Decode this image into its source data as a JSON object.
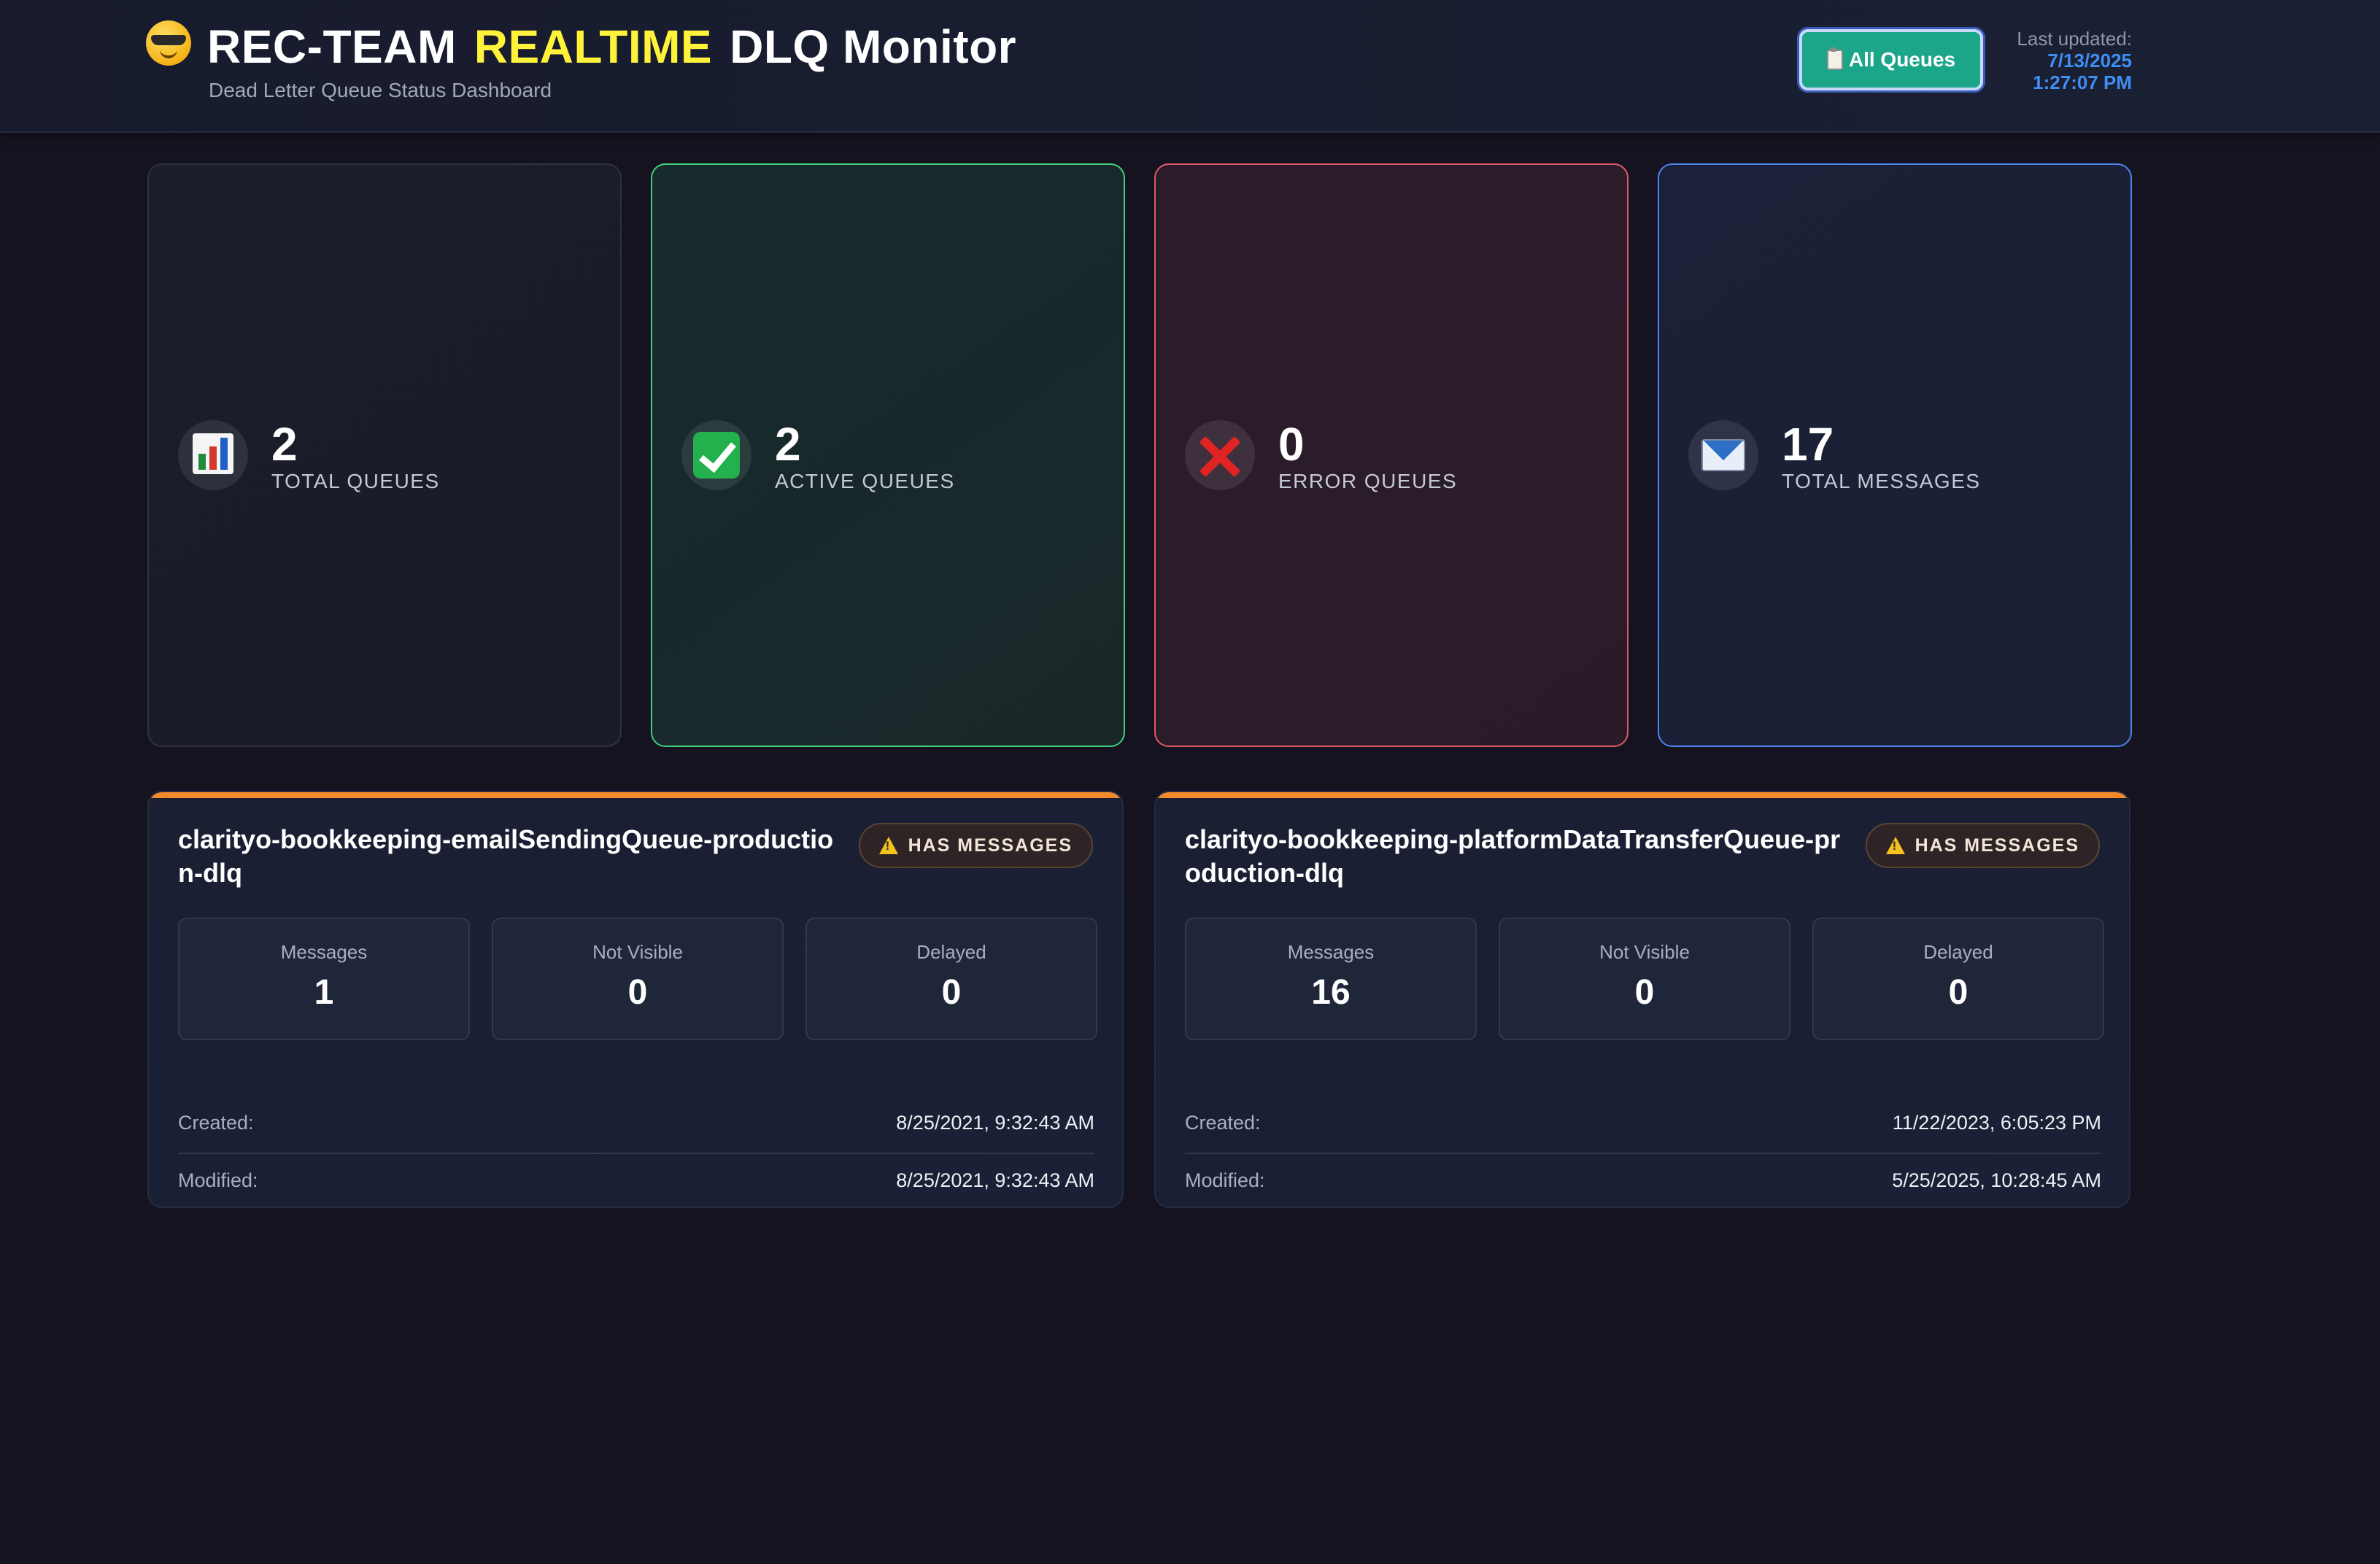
{
  "header": {
    "title_part1": "REC-TEAM",
    "title_part2": "REALTIME",
    "title_part3": "DLQ Monitor",
    "subtitle": "Dead Letter Queue Status Dashboard",
    "brand_icon": "sunglasses-face-icon",
    "all_queues_button": "All Queues",
    "all_queues_icon": "clipboard-icon",
    "last_updated_label": "Last updated:",
    "last_updated_date": "7/13/2025",
    "last_updated_time": "1:27:07 PM"
  },
  "stats": [
    {
      "value": "2",
      "label": "TOTAL QUEUES",
      "icon": "bar-chart-icon"
    },
    {
      "value": "2",
      "label": "ACTIVE QUEUES",
      "icon": "check-mark-icon",
      "accent": "#3fd07a"
    },
    {
      "value": "0",
      "label": "ERROR QUEUES",
      "icon": "cross-mark-icon",
      "accent": "#e0586a"
    },
    {
      "value": "17",
      "label": "TOTAL MESSAGES",
      "icon": "envelope-icon",
      "accent": "#4d84ee"
    }
  ],
  "queues": [
    {
      "name": "clarityo-bookkeeping-emailSendingQueue-production-dlq",
      "status": "HAS MESSAGES",
      "messages_label": "Messages",
      "messages": "1",
      "not_visible_label": "Not Visible",
      "not_visible": "0",
      "delayed_label": "Delayed",
      "delayed": "0",
      "created_label": "Created:",
      "created": "8/25/2021, 9:32:43 AM",
      "modified_label": "Modified:",
      "modified": "8/25/2021, 9:32:43 AM"
    },
    {
      "name": "clarityo-bookkeeping-platformDataTransferQueue-production-dlq",
      "status": "HAS MESSAGES",
      "messages_label": "Messages",
      "messages": "16",
      "not_visible_label": "Not Visible",
      "not_visible": "0",
      "delayed_label": "Delayed",
      "delayed": "0",
      "created_label": "Created:",
      "created": "11/22/2023, 6:05:23 PM",
      "modified_label": "Modified:",
      "modified": "5/25/2025, 10:28:45 AM"
    }
  ],
  "colors": {
    "background": "#14131f",
    "title_accent": "#fff23a",
    "button": "#1ba68a",
    "timestamp": "#3f8ef2",
    "warning_bar": "#f08a2c"
  }
}
